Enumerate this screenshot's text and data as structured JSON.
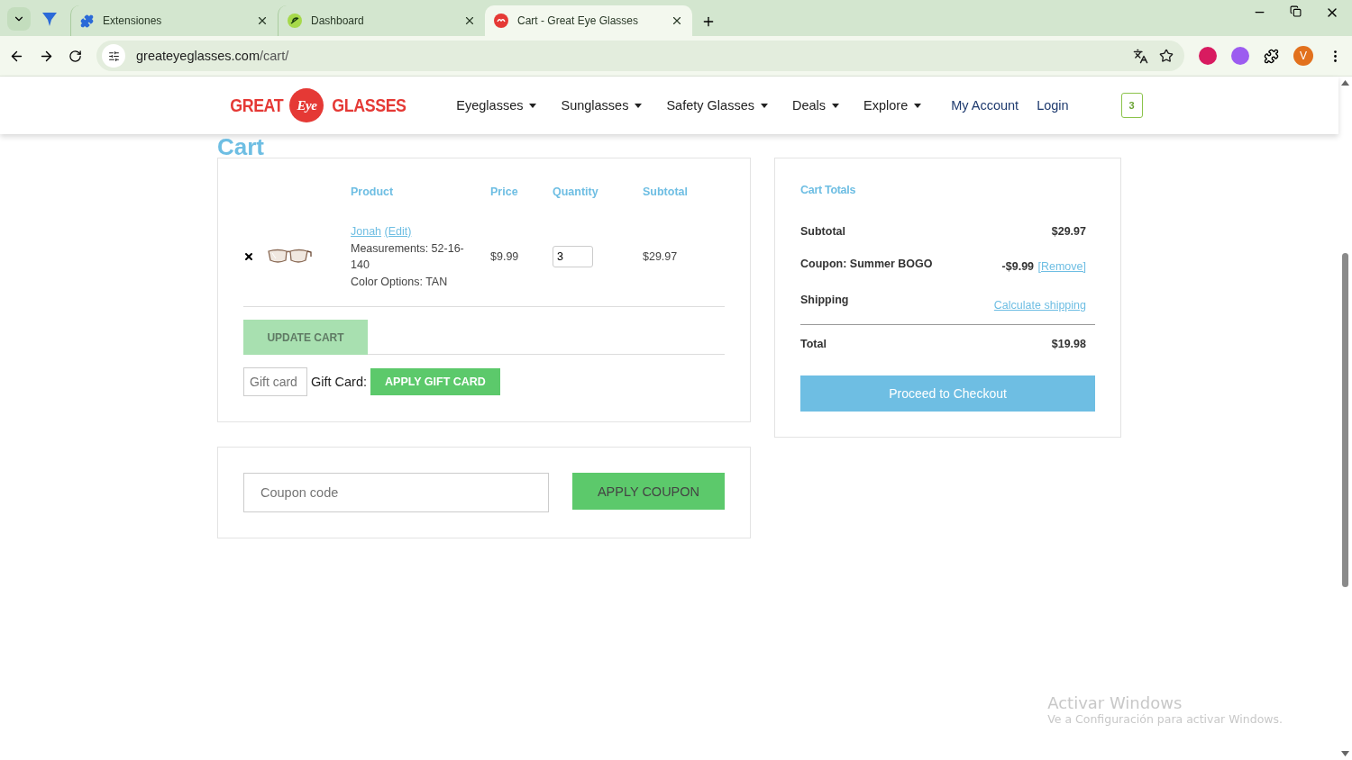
{
  "browser": {
    "tabs": [
      {
        "title": "Extensiones",
        "selected": false,
        "kind": "puzzle"
      },
      {
        "title": "Dashboard",
        "selected": false,
        "kind": "dashboard"
      },
      {
        "title": "Cart - Great Eye Glasses",
        "selected": true,
        "kind": "site"
      }
    ],
    "url_host": "greateyeglasses.com",
    "url_path": "/cart/",
    "profile_initial": "V"
  },
  "header": {
    "logo": [
      "GREAT",
      "Eye",
      "GLASSES"
    ],
    "nav": [
      {
        "label": "Eyeglasses"
      },
      {
        "label": "Sunglasses"
      },
      {
        "label": "Safety Glasses"
      },
      {
        "label": "Deals"
      },
      {
        "label": "Explore"
      }
    ],
    "account": "My Account",
    "login": "Login",
    "cart_count": "3"
  },
  "page_title": "Cart",
  "cart": {
    "columns": [
      "Product",
      "Price",
      "Quantity",
      "Subtotal"
    ],
    "items": [
      {
        "name": "Jonah",
        "edit": "(Edit)",
        "measurements": "Measurements: 52-16-140",
        "color_option": "Color Options: TAN",
        "price": "$9.99",
        "quantity": "3",
        "subtotal": "$29.97"
      }
    ],
    "update_button": {
      "label": "UPDATE CART",
      "disabled": true
    },
    "gift_card": {
      "placeholder": "Gift card",
      "label": "Gift Card:",
      "button": "APPLY GIFT CARD"
    }
  },
  "coupon": {
    "placeholder": "Coupon code",
    "button": "APPLY COUPON"
  },
  "totals": {
    "title": "Cart Totals",
    "subtotal_label": "Subtotal",
    "subtotal": "$29.97",
    "coupon_label": "Coupon: Summer BOGO",
    "coupon_amount": "-$9.99",
    "coupon_remove": "[Remove]",
    "shipping_label": "Shipping",
    "shipping_link": "Calculate shipping",
    "total_label": "Total",
    "total": "$19.98",
    "checkout": "Proceed to Checkout"
  },
  "windows_notice": {
    "title": "Activar Windows",
    "text": "Ve a Configuración para activar Windows."
  }
}
